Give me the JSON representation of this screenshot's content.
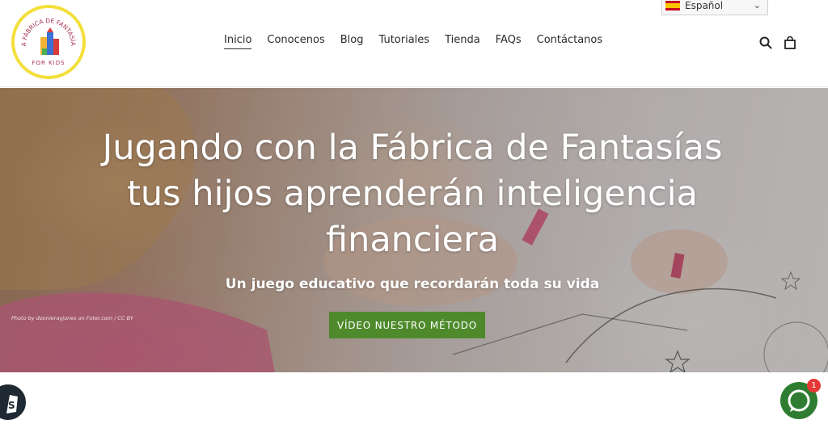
{
  "logo": {
    "arc_text": "LA FÁBRICA DE FANTASÍAS",
    "sub_text": "FOR KIDS"
  },
  "language": {
    "selected": "Español",
    "flag": "spain-flag"
  },
  "nav": {
    "items": [
      {
        "label": "Inicio",
        "active": true
      },
      {
        "label": "Conocenos"
      },
      {
        "label": "Blog"
      },
      {
        "label": "Tutoriales"
      },
      {
        "label": "Tienda"
      },
      {
        "label": "FAQs"
      },
      {
        "label": "Contáctanos"
      }
    ]
  },
  "icons": {
    "search": "search-icon",
    "cart": "shopping-bag-icon",
    "chat": "chat-icon",
    "shopify": "shopify-bag-icon"
  },
  "hero": {
    "title": "Jugando con la Fábrica de Fantasías tus hijos aprenderán inteligencia financiera",
    "subtitle": "Un juego educativo que recordarán toda su vida",
    "cta_label": "VÍDEO NUESTRO MÉTODO",
    "credit": "Photo by donnierayjones on Foter.com / CC BY"
  },
  "chat": {
    "unread": "1"
  },
  "colors": {
    "cta": "#4e8a2c",
    "logo_ring": "#f3df3a",
    "chat": "#2e7d32",
    "badge": "#e53935"
  }
}
